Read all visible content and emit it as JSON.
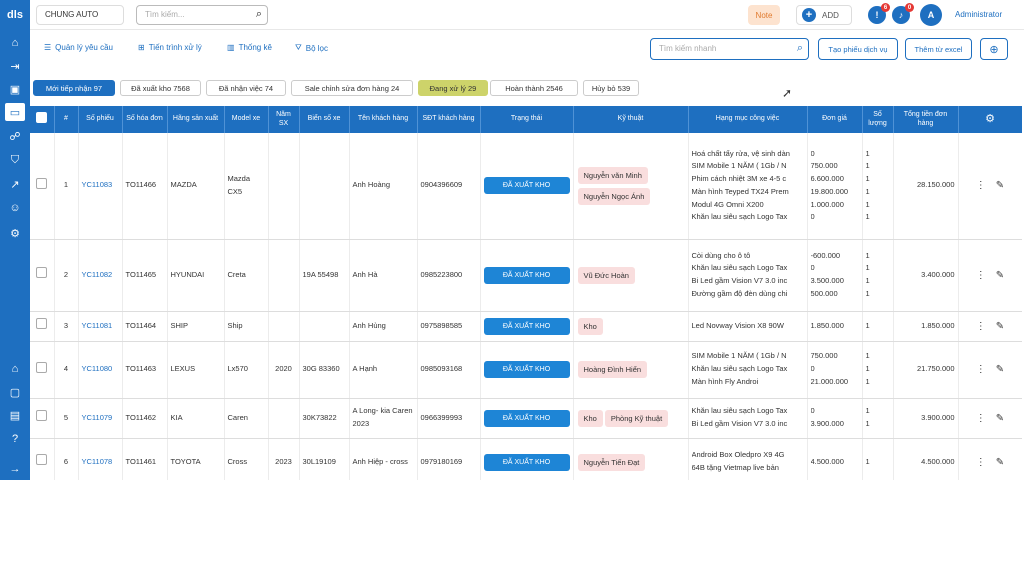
{
  "logo": "dls",
  "header": {
    "company": "CHUNG AUTO",
    "search_placeholder": "Tìm kiếm...",
    "note_label": "Note",
    "add_label": "ADD",
    "alert_count": "6",
    "bell_count": "0",
    "avatar": "A",
    "user": "Administrator"
  },
  "toolbar": {
    "requests": "Quản lý yêu cầu",
    "progress": "Tiến trình xử lý",
    "stats": "Thống kê",
    "filter": "Bộ lọc",
    "search_placeholder": "Tìm kiếm nhanh",
    "create": "Tạo phiếu dịch vụ",
    "excel": "Thêm từ excel"
  },
  "tabs": [
    {
      "label": "Mới tiếp nhận 97",
      "style": "blue"
    },
    {
      "label": "Đã xuất kho 7568",
      "style": "plain"
    },
    {
      "label": "Đã nhận việc 74",
      "style": "plain"
    },
    {
      "label": "Sale chỉnh sửa đơn hàng 24",
      "style": "plain"
    },
    {
      "label": "Đang xử lý 29",
      "style": "yellow"
    },
    {
      "label": "Hoàn thành 2546",
      "style": "plain"
    },
    {
      "label": "Hủy bỏ 539",
      "style": "plain"
    }
  ],
  "columns": [
    "#",
    "Số phiếu",
    "Số hóa đơn",
    "Hãng sản xuất",
    "Model xe",
    "Năm SX",
    "Biển số xe",
    "Tên khách hàng",
    "SĐT khách hàng",
    "Trạng thái",
    "Kỹ thuật",
    "Hạng mục công việc",
    "Đơn giá",
    "Số lượng",
    "Tổng tiền đơn hàng"
  ],
  "status_label": "ĐÃ XUẤT KHO",
  "rows": [
    {
      "n": "1",
      "ticket": "YC11083",
      "invoice": "TO11466",
      "maker": "MAZDA",
      "model": "Mazda CX5",
      "year": "",
      "plate": "",
      "customer": "Anh Hoàng",
      "phone": "0904396609",
      "techs": [
        "Nguyễn văn Minh",
        "Nguyễn Ngọc Ánh"
      ],
      "items": [
        "Hoá chất tẩy rửa, vệ sinh dàn",
        "SIM Mobile 1 NĂM ( 1Gb / N",
        "Phim cách nhiệt 3M xe 4-5 c",
        "Màn hình Teyped TX24 Prem",
        "Modul 4G Omni X200",
        "Khăn lau siêu sạch Logo Tax"
      ],
      "prices": [
        "0",
        "750.000",
        "6.600.000",
        "19.800.000",
        "1.000.000",
        "0"
      ],
      "qty": [
        "1",
        "1",
        "1",
        "1",
        "1",
        "1"
      ],
      "total": "28.150.000"
    },
    {
      "n": "2",
      "ticket": "YC11082",
      "invoice": "TO11465",
      "maker": "HYUNDAI",
      "model": "Creta",
      "year": "",
      "plate": "19A 55498",
      "customer": "Anh Hà",
      "phone": "0985223800",
      "techs": [
        "Vũ Đức Hoàn"
      ],
      "items": [
        "Còi dùng cho ô tô",
        "Khăn lau siêu sạch Logo Tax",
        "Bi Led gầm Vision V7 3.0 inc",
        "Đường gầm độ đèn dùng chi"
      ],
      "prices": [
        "-600.000",
        "0",
        "3.500.000",
        "500.000"
      ],
      "qty": [
        "1",
        "1",
        "1",
        "1"
      ],
      "total": "3.400.000"
    },
    {
      "n": "3",
      "ticket": "YC11081",
      "invoice": "TO11464",
      "maker": "SHIP",
      "model": "Ship",
      "year": "",
      "plate": "",
      "customer": "Anh Hùng",
      "phone": "0975898585",
      "techs": [
        "Kho"
      ],
      "items": [
        "Led Novway Vision X8 90W"
      ],
      "prices": [
        "1.850.000"
      ],
      "qty": [
        "1"
      ],
      "total": "1.850.000"
    },
    {
      "n": "4",
      "ticket": "YC11080",
      "invoice": "TO11463",
      "maker": "LEXUS",
      "model": "Lx570",
      "year": "2020",
      "plate": "30G 83360",
      "customer": "A Hạnh",
      "phone": "0985093168",
      "techs": [
        "Hoàng Đình Hiển"
      ],
      "items": [
        "SIM Mobile 1 NĂM ( 1Gb / N",
        "Khăn lau siêu sạch Logo Tax",
        "Màn hình Fly Androi"
      ],
      "prices": [
        "750.000",
        "0",
        "21.000.000"
      ],
      "qty": [
        "1",
        "1",
        "1"
      ],
      "total": "21.750.000"
    },
    {
      "n": "5",
      "ticket": "YC11079",
      "invoice": "TO11462",
      "maker": "KIA",
      "model": "Caren",
      "year": "",
      "plate": "30K73822",
      "customer": "A Long- kia Caren 2023",
      "phone": "0966399993",
      "techs": [
        "Kho",
        "Phòng Kỹ thuật"
      ],
      "items": [
        "Khăn lau siêu sạch Logo Tax",
        "Bi Led gầm Vision V7 3.0 inc"
      ],
      "prices": [
        "0",
        "3.900.000"
      ],
      "qty": [
        "1",
        "1"
      ],
      "total": "3.900.000"
    },
    {
      "n": "6",
      "ticket": "YC11078",
      "invoice": "TO11461",
      "maker": "TOYOTA",
      "model": "Cross",
      "year": "2023",
      "plate": "30L19109",
      "customer": "Anh Hiệp - cross",
      "phone": "0979180169",
      "techs": [
        "Nguyễn Tiến Đạt"
      ],
      "items": [
        "Android Box Oledpro X9 4G",
        "64B tặng Vietmap live bản"
      ],
      "prices": [
        "4.500.000",
        ""
      ],
      "qty": [
        "1",
        ""
      ],
      "total": "4.500.000"
    }
  ]
}
